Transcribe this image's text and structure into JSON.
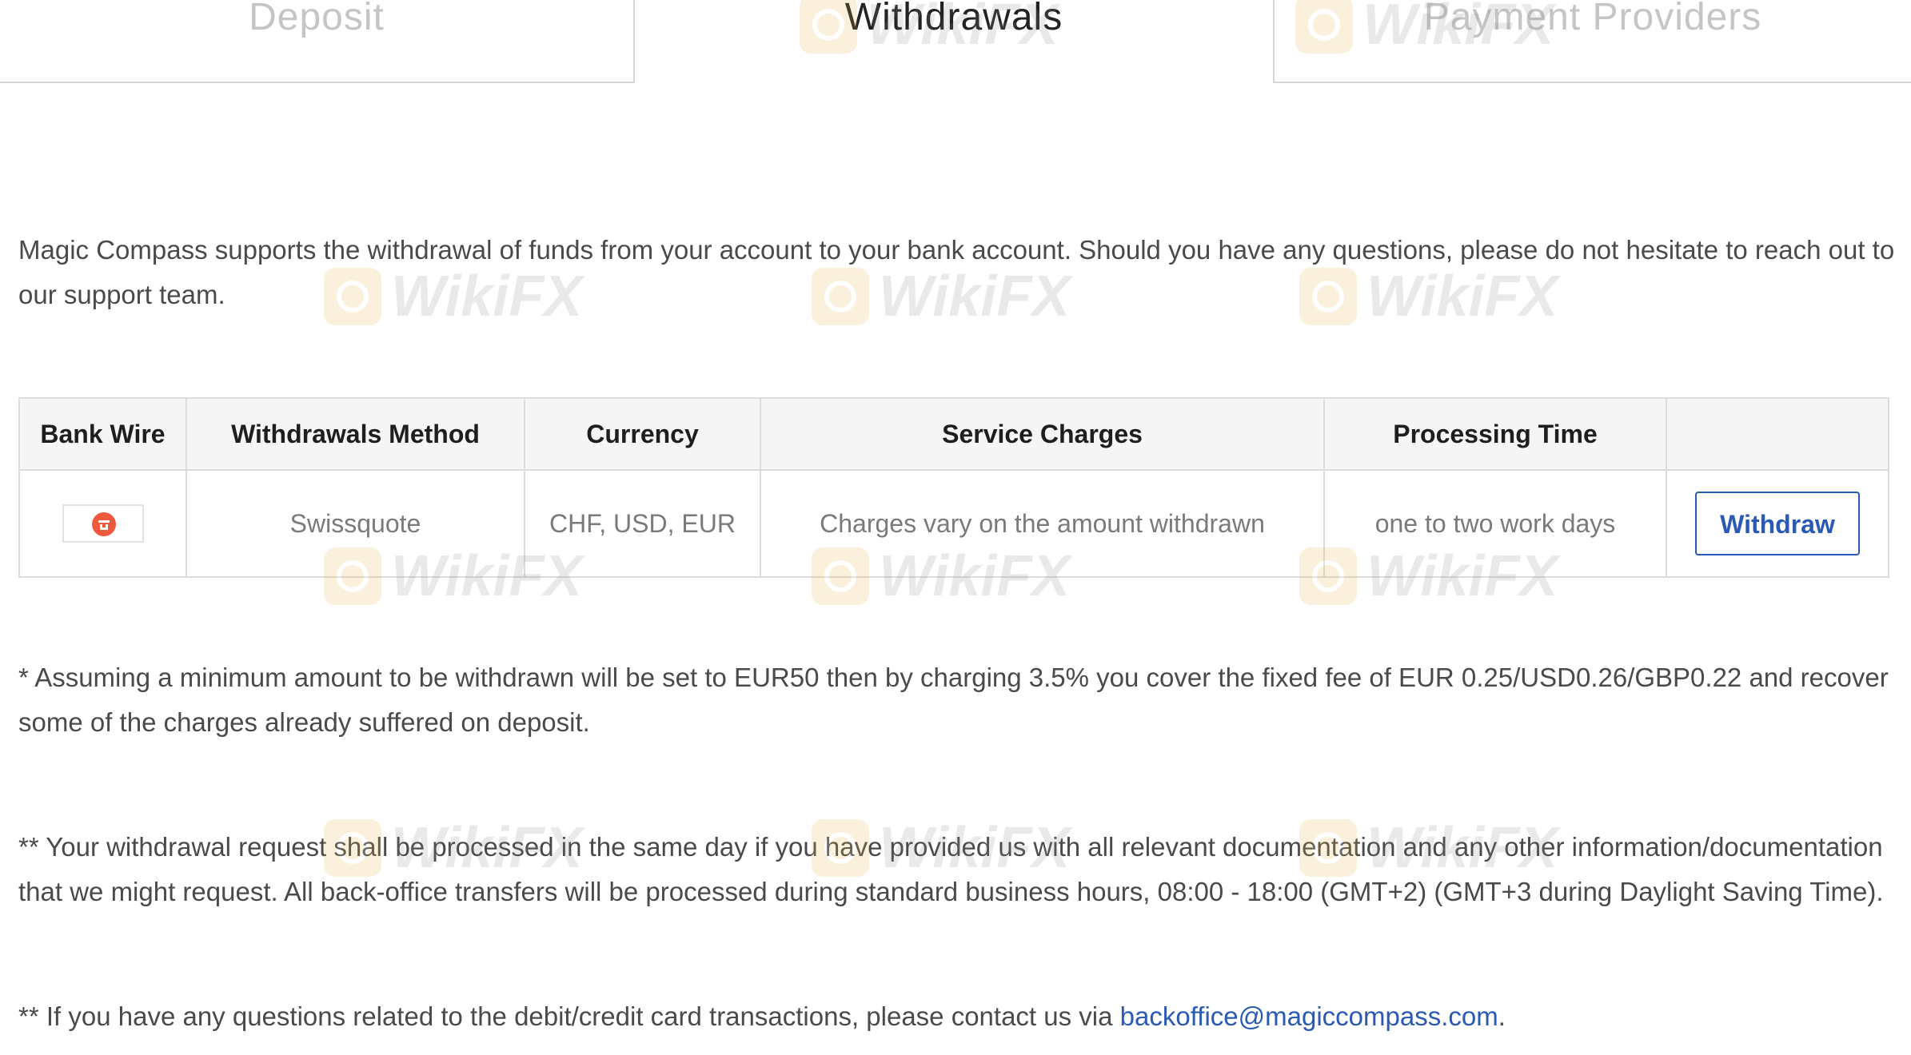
{
  "tabs": [
    {
      "label": "Deposit",
      "active": false
    },
    {
      "label": "Withdrawals",
      "active": true
    },
    {
      "label": "Payment Providers",
      "active": false
    }
  ],
  "intro": "Magic Compass supports the withdrawal of funds from your account to your bank account. Should you have any questions, please do not hesitate to reach out to our support team.",
  "table": {
    "headers": [
      "Bank Wire",
      "Withdrawals Method",
      "Currency",
      "Service Charges",
      "Processing Time",
      ""
    ],
    "row": {
      "logo_icon": "swissquote-logo-icon",
      "method": "Swissquote",
      "currency": "CHF, USD, EUR",
      "service_charges": "Charges vary on the amount withdrawn",
      "processing_time": "one to two work days",
      "action_label": "Withdraw"
    }
  },
  "notes": {
    "note1": "* Assuming a minimum amount to be withdrawn will be set to EUR50 then by charging 3.5% you cover the fixed fee of EUR 0.25/USD0.26/GBP0.22 and recover some of the charges already suffered on deposit.",
    "note2": "** Your withdrawal request shall be processed in the same day if you have provided us with all relevant documentation and any other information/documentation that we might request. All back-office transfers will be processed during standard business hours, 08:00 - 18:00 (GMT+2) (GMT+3 during Daylight Saving Time).",
    "note3_prefix": "** If you have any questions related to the debit/credit card transactions, please contact us via ",
    "note3_email": "backoffice@magiccompass.com",
    "note3_suffix": "."
  },
  "watermark": {
    "text": "WikiFX",
    "icon": "wikifx-logo-icon"
  },
  "colors": {
    "link": "#2a5ab3",
    "logo": "#ef5a3c",
    "watermark": "#e8b23c"
  }
}
